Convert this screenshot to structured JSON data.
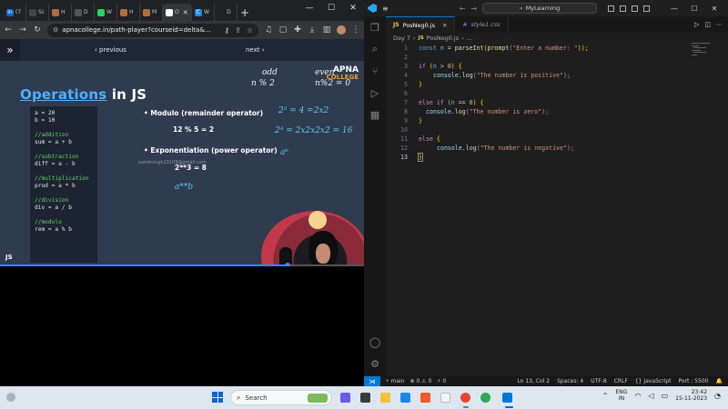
{
  "browser": {
    "tabs": [
      {
        "label": "(7",
        "color": "#0a66c2",
        "glyph": "in"
      },
      {
        "label": "Sc",
        "color": "#444444",
        "glyph": ""
      },
      {
        "label": "H",
        "color": "#b0703c",
        "glyph": ""
      },
      {
        "label": "D",
        "color": "#555555",
        "glyph": ""
      },
      {
        "label": "W",
        "color": "#25d366",
        "glyph": ""
      },
      {
        "label": "H",
        "color": "#b0703c",
        "glyph": ""
      },
      {
        "label": "M",
        "color": "#b0703c",
        "glyph": ""
      },
      {
        "label": "O",
        "color": "#ffffff",
        "glyph": ""
      },
      {
        "label": "W",
        "color": "#1e88e5",
        "glyph": "C"
      },
      {
        "label": "D",
        "color": "#222222",
        "glyph": ""
      }
    ],
    "url": "apnacollege.in/path-player?courseid=delta&...",
    "player": {
      "prev": "‹ previous",
      "next": "next ›"
    }
  },
  "video": {
    "title_highlight": "Operations",
    "title_rest": " in JS",
    "code": {
      "a": "a = 20",
      "b": "b = 10",
      "c1": "//addition",
      "l1": "sum = a + b",
      "c2": "//subtraction",
      "l2": "diff = a - b",
      "c3": "//multiplication",
      "l3": "prod = a * b",
      "c4": "//division",
      "l4": "div = a / b",
      "c5": "//modulo",
      "l5": "rem = a % b"
    },
    "bullet1": "• Modulo (remainder operator)",
    "example1": "12 % 5 = 2",
    "bullet2": "• Exponentiation (power operator)",
    "example2": "2**3 = 8",
    "watermark": "sumitsingh23109@gmail.com",
    "hand": {
      "odd": "odd",
      "oddmod": "n % 2",
      "even": "even",
      "evenmod": "n%2 = 0",
      "pow1": "2² = 4 =2x2",
      "pow2": "2⁴ = 2x2x2x2 = 16",
      "pow3": "aᵇ",
      "axb": "a**b"
    },
    "brand1": "APNA",
    "brand2": "COLLEGE",
    "js_mark": "JS",
    "progress": 0.79
  },
  "vscode": {
    "search_placeholder": "MyLearning",
    "tabs": [
      {
        "type": "JS",
        "name": "PosNeg0.js"
      },
      {
        "type": "#",
        "name": "style1.css"
      }
    ],
    "breadcrumb": [
      "Day 7",
      "JS",
      "PosNeg0.js",
      "..."
    ],
    "lines": [
      "1",
      "2",
      "3",
      "4",
      "5",
      "6",
      "7",
      "8",
      "9",
      "10",
      "11",
      "12",
      "13"
    ],
    "code": {
      "l1_kw": "const",
      "l1_var": " n",
      "l1_eq": " = ",
      "l1_fn": "parseInt",
      "l1_p1": "(",
      "l1_fn2": "prompt",
      "l1_p2": "(",
      "l1_str": "\"Enter a number: \"",
      "l1_end": "));",
      "if_kw": "if",
      "if_cond_open": " (",
      "if_var": "n",
      "if_op": " > ",
      "if_num": "0",
      "if_close": ") {",
      "log": "console",
      "dot": ".",
      "logfn": "log",
      "pos_str": "\"The number is positive\"",
      "zero_str": "\"The number is zero\"",
      "neg_str": "\"The number is negative\"",
      "paren_open": "(",
      "paren_close": ");",
      "brace_close": "}",
      "else_kw": "else",
      "elseif_kw": "else if",
      "eq_op": " == ",
      "brace_open": " {"
    },
    "status": {
      "branch": "main",
      "errors": "⊗ 0 ⚠ 0",
      "ports": "⚡ 0",
      "position": "Ln 13, Col 2",
      "spaces": "Spaces: 4",
      "encoding": "UTF-8",
      "eol": "CRLF",
      "lang": "{} JavaScript",
      "port": "Port : 5500"
    }
  },
  "taskbar": {
    "search_label": "Search",
    "lang": "ENG",
    "region": "IN",
    "time": "23:42",
    "date": "15-11-2023"
  }
}
